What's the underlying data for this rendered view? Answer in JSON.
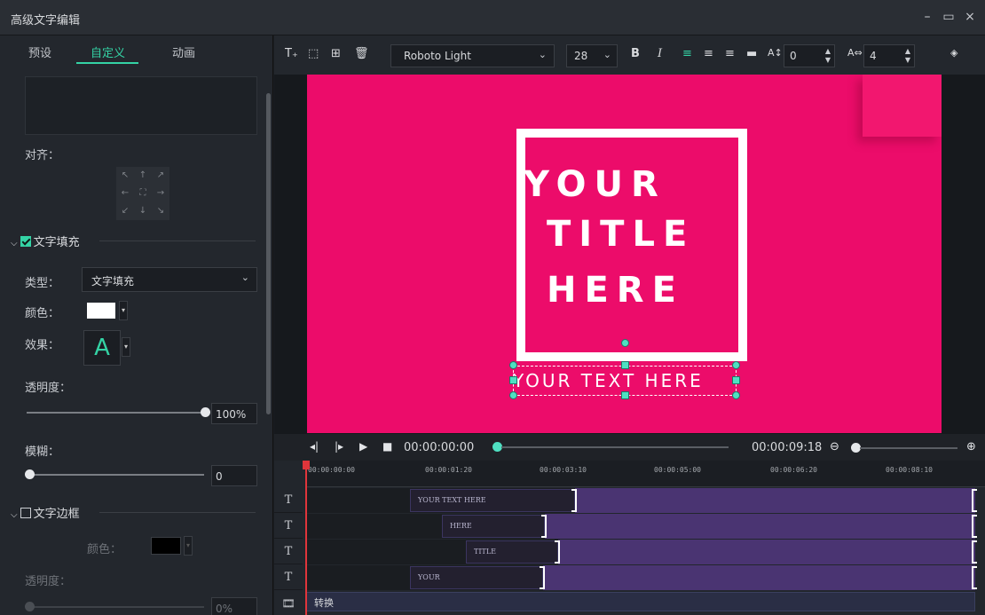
{
  "window": {
    "title": "高级文字编辑",
    "minimize_icon": "minimize-icon",
    "maximize_icon": "maximize-icon",
    "close_icon": "close-icon"
  },
  "left_panel": {
    "tabs": [
      {
        "label": "预设"
      },
      {
        "label": "自定义",
        "active": true
      },
      {
        "label": "动画"
      }
    ],
    "align_label": "对齐：",
    "text_fill": {
      "section_title": "文字填充",
      "checked": true,
      "type_label": "类型：",
      "type_value": "文字填充",
      "color_label": "颜色：",
      "color_value": "#ffffff",
      "effect_label": "效果：",
      "effect_glyph": "A",
      "opacity_label": "透明度：",
      "opacity_value": "100%",
      "blur_label": "模糊：",
      "blur_value": "0"
    },
    "text_border": {
      "section_title": "文字边框",
      "checked": false,
      "color_label": "颜色：",
      "color_value": "#000000",
      "opacity_label": "透明度：",
      "opacity_value": "0%"
    }
  },
  "toolbar": {
    "icons": [
      "add-text-icon",
      "add-shape-icon",
      "add-image-icon",
      "delete-icon"
    ],
    "font_family": "Roboto Light",
    "font_size": "28",
    "bold": "B",
    "italic": "I",
    "char_spacing": "0",
    "line_spacing": "4"
  },
  "canvas": {
    "background": "#ec0c6a",
    "title_lines": [
      "YOUR",
      "TITLE",
      "HERE"
    ],
    "subtitle": "YOUR TEXT HERE"
  },
  "playback": {
    "current_time": "00:00:00:00",
    "total_time": "00:00:09:18"
  },
  "timeline": {
    "ticks": [
      "00:00:00:00",
      "00:00:01:20",
      "00:00:03:10",
      "00:00:05:00",
      "00:00:06:20",
      "00:00:08:10"
    ],
    "tracks": [
      {
        "label": "T",
        "clip": "YOUR TEXT HERE"
      },
      {
        "label": "T",
        "clip": "HERE"
      },
      {
        "label": "T",
        "clip": "TITLE"
      },
      {
        "label": "T",
        "clip": "YOUR"
      }
    ],
    "bottom_track_label": "转换"
  }
}
